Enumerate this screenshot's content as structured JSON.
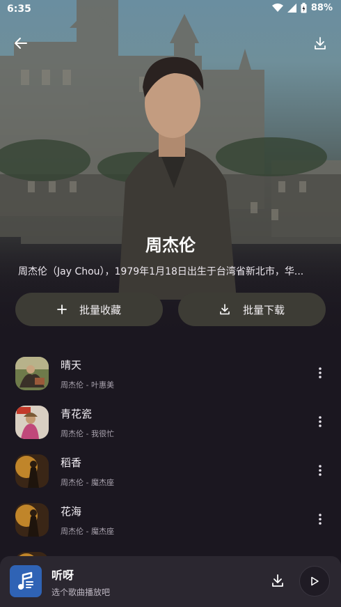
{
  "status_bar": {
    "time": "6:35",
    "battery": "88%"
  },
  "artist": {
    "name": "周杰伦",
    "description": "周杰伦（Jay Chou），1979年1月18日出生于台湾省新北市，华..."
  },
  "actions": {
    "collect_label": "批量收藏",
    "download_label": "批量下载"
  },
  "songs": [
    {
      "title": "晴天",
      "subtitle": "周杰伦 - 叶惠美"
    },
    {
      "title": "青花瓷",
      "subtitle": "周杰伦 - 我很忙"
    },
    {
      "title": "稻香",
      "subtitle": "周杰伦 - 魔杰座"
    },
    {
      "title": "花海",
      "subtitle": "周杰伦 - 魔杰座"
    }
  ],
  "player": {
    "title": "听呀",
    "subtitle": "选个歌曲播放吧"
  },
  "colors": {
    "background": "#1b1720",
    "pill": "#3d3c35",
    "player_bg": "#2b2730",
    "app_icon": "#2f63b5"
  }
}
